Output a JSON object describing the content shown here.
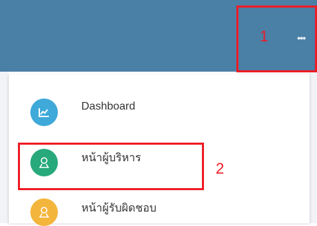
{
  "header": {
    "more_label": "•••"
  },
  "annotations": [
    {
      "label": "1",
      "color": "#ee1c25"
    },
    {
      "label": "2",
      "color": "#ee1c25"
    }
  ],
  "menu": {
    "items": [
      {
        "label": "Dashboard",
        "icon": "chart-icon",
        "color": "#3fa9d9"
      },
      {
        "label": "หน้าผู้บริหาร",
        "icon": "user-icon",
        "color": "#27a97c"
      },
      {
        "label": "หน้าผู้รับผิดชอบ",
        "icon": "user-icon",
        "color": "#f3b53b"
      }
    ]
  }
}
